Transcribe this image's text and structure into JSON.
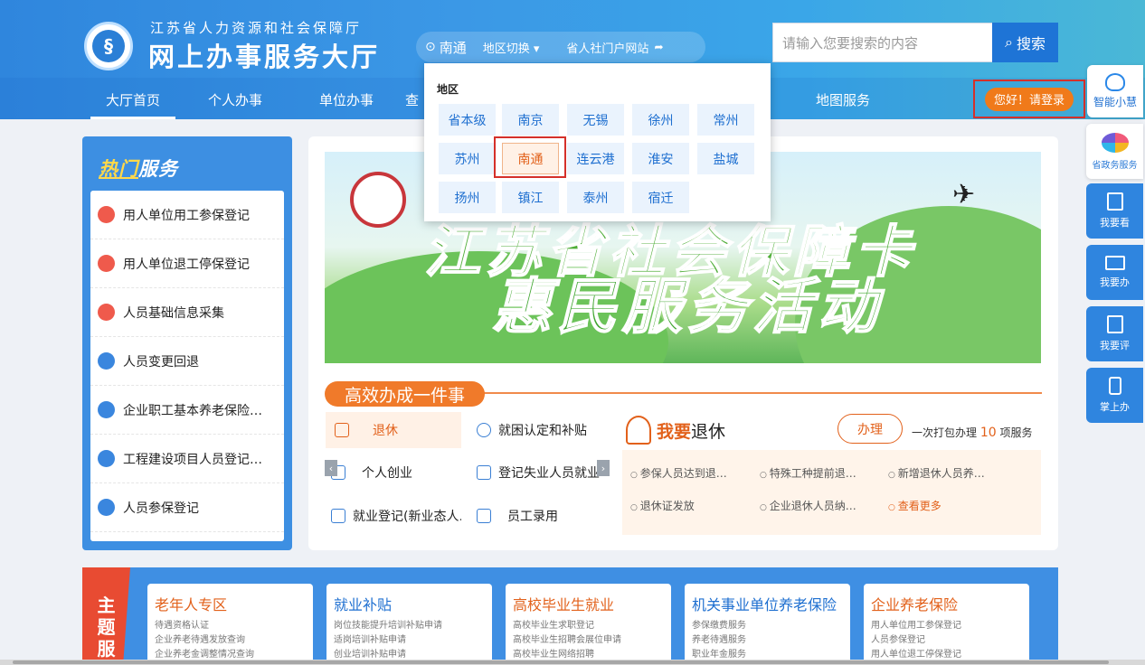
{
  "header": {
    "org_name": "江苏省人力资源和社会保障厅",
    "site_title": "网上办事服务大厅",
    "location": "南通",
    "region_switch": "地区切换 ▾",
    "portal_link": "省人社门户网站",
    "search_placeholder": "请输入您要搜索的内容",
    "search_button": "搜索",
    "login": "您好！请登录"
  },
  "nav": {
    "items": [
      "大厅首页",
      "个人办事",
      "单位办事",
      "查"
    ],
    "map": "地图服务"
  },
  "region_dropdown": {
    "label": "地区",
    "cities": [
      "省本级",
      "南京",
      "无锡",
      "徐州",
      "常州",
      "苏州",
      "南通",
      "连云港",
      "淮安",
      "盐城",
      "扬州",
      "镇江",
      "泰州",
      "宿迁"
    ],
    "selected": "南通"
  },
  "float_bar": {
    "ai": "智能小慧",
    "items": [
      "省政务服务",
      "我要看",
      "我要办",
      "我要评",
      "掌上办"
    ]
  },
  "hot": {
    "title_highlight": "热门",
    "title_rest": "服务",
    "items": [
      "用人单位用工参保登记",
      "用人单位退工停保登记",
      "人员基础信息采集",
      "人员变更回退",
      "企业职工基本养老保险…",
      "工程建设项目人员登记…",
      "人员参保登记"
    ]
  },
  "colors": {
    "hot_dots": [
      "#ef5a4c",
      "#ef5a4c",
      "#ef5a4c",
      "#3a86de",
      "#3a86de",
      "#3a86de",
      "#3a86de"
    ]
  },
  "banner": {
    "line1": "江苏省社会保障卡",
    "line2": "惠民服务活动"
  },
  "efficient": {
    "title": "高效办成一件事",
    "services": [
      "退休",
      "就困认定和补贴",
      "个人创业",
      "登记失业人员就业",
      "就业登记(新业态人…",
      "员工录用"
    ],
    "retire_title_bold": "我要",
    "retire_title_rest": "退休",
    "handle": "办理",
    "pack_prefix": "一次打包办理",
    "pack_num": "10",
    "pack_suffix": "项服务",
    "links": [
      "参保人员达到退…",
      "特殊工种提前退…",
      "新增退休人员养…",
      "退休证发放",
      "企业退休人员纳…",
      "查看更多"
    ]
  },
  "themes": {
    "label": [
      "主",
      "题",
      "服"
    ],
    "cards": [
      {
        "title": "老年人专区",
        "lines": [
          "待遇资格认证",
          "企业养老待遇发放查询",
          "企业养老金调整情况查询"
        ]
      },
      {
        "title": "就业补贴",
        "lines": [
          "岗位技能提升培训补贴申请",
          "适岗培训补贴申请",
          "创业培训补贴申请"
        ]
      },
      {
        "title": "高校毕业生就业",
        "lines": [
          "高校毕业生求职登记",
          "高校毕业生招聘会展位申请",
          "高校毕业生网络招聘"
        ]
      },
      {
        "title": "机关事业单位养老保险",
        "lines": [
          "参保缴费服务",
          "养老待遇服务",
          "职业年金服务"
        ]
      },
      {
        "title": "企业养老保险",
        "lines": [
          "用人单位用工参保登记",
          "人员参保登记",
          "用人单位退工停保登记"
        ]
      }
    ]
  }
}
